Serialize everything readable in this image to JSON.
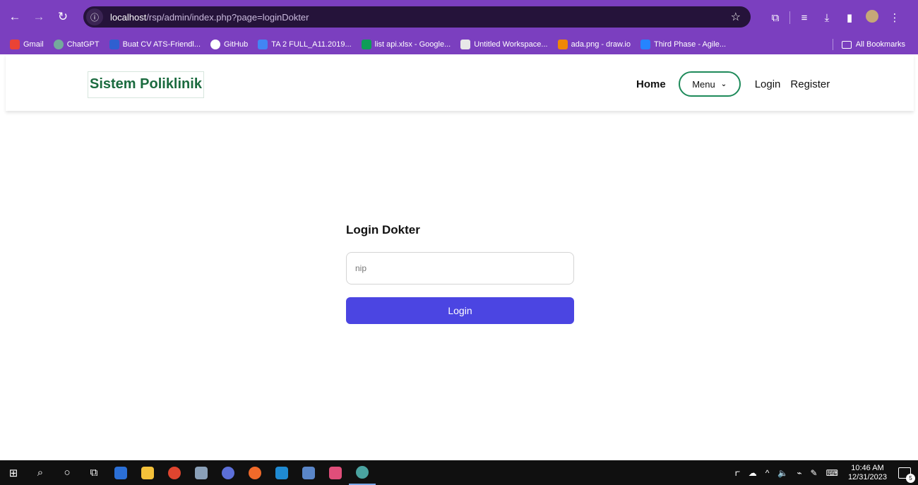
{
  "browser": {
    "url_host": "localhost",
    "url_path": "/rsp/admin/index.php?page=loginDokter",
    "back_icon": "arrow-left-icon",
    "forward_icon": "arrow-right-icon",
    "reload_icon": "reload-icon",
    "bookmarks": [
      {
        "label": "Gmail",
        "color": "#ea4335"
      },
      {
        "label": "ChatGPT",
        "color": "#74aa9c"
      },
      {
        "label": "Buat CV ATS-Friendl...",
        "color": "#2f5fd0"
      },
      {
        "label": "GitHub",
        "color": "#ffffff"
      },
      {
        "label": "TA 2 FULL_A11.2019...",
        "color": "#4285f4"
      },
      {
        "label": "list api.xlsx - Google...",
        "color": "#0f9d58"
      },
      {
        "label": "Untitled Workspace...",
        "color": "#e8e8e8"
      },
      {
        "label": "ada.png - draw.io",
        "color": "#f08705"
      },
      {
        "label": "Third Phase - Agile...",
        "color": "#2684ff"
      }
    ],
    "all_bookmarks": "All Bookmarks"
  },
  "site": {
    "brand": "Sistem Poliklinik",
    "nav": {
      "home": "Home",
      "menu": "Menu",
      "login": "Login",
      "register": "Register"
    },
    "accent": "#1e8a5a"
  },
  "login": {
    "title": "Login Dokter",
    "nip_placeholder": "nip",
    "nip_value": "",
    "submit": "Login",
    "button_color": "#4b45e2"
  },
  "taskbar": {
    "time": "10:46 AM",
    "date": "12/31/2023",
    "notification_count": "5"
  }
}
